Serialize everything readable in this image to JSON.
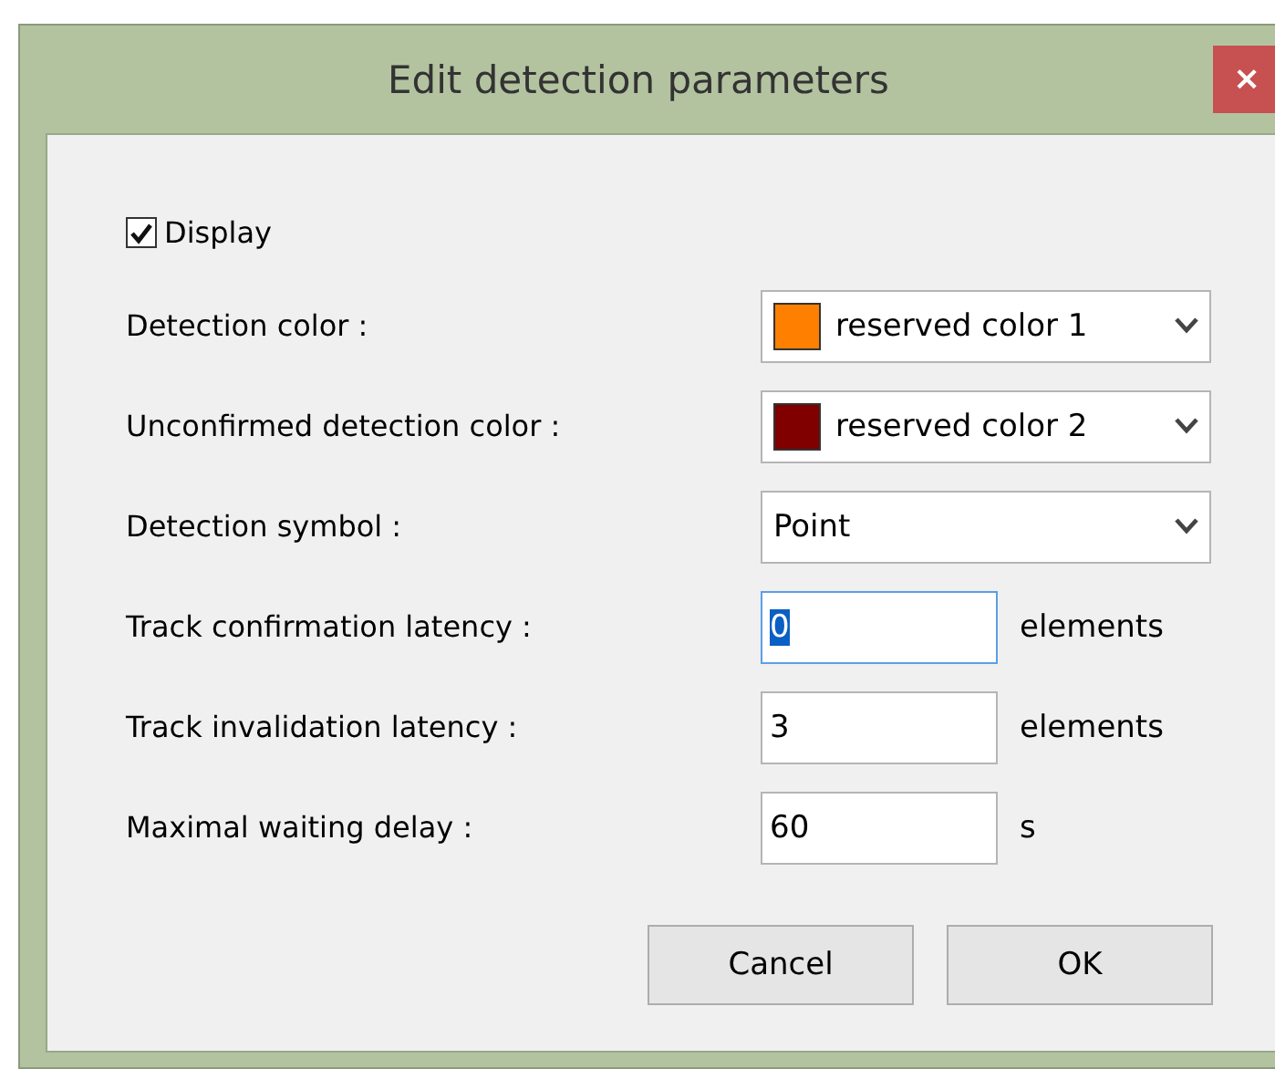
{
  "window": {
    "title": "Edit detection parameters",
    "close": "×"
  },
  "display": {
    "label": "Display",
    "checked": true
  },
  "fields": [
    {
      "kind": "color_combo",
      "label": "Detection color :",
      "value": "reserved color 1",
      "color": "#ff8000"
    },
    {
      "kind": "color_combo",
      "label": "Unconfirmed detection color :",
      "value": "reserved color 2",
      "color": "#800000"
    },
    {
      "kind": "combo",
      "label": "Detection symbol  :",
      "value": "Point"
    },
    {
      "kind": "input",
      "label": "Track confirmation latency :",
      "value": "0",
      "unit": "elements",
      "focused": true
    },
    {
      "kind": "input",
      "label": "Track invalidation latency :",
      "value": "3",
      "unit": "elements",
      "focused": false
    },
    {
      "kind": "input",
      "label": "Maximal waiting delay :",
      "value": "60",
      "unit": "s",
      "focused": false
    }
  ],
  "buttons": [
    "Cancel",
    "OK"
  ]
}
